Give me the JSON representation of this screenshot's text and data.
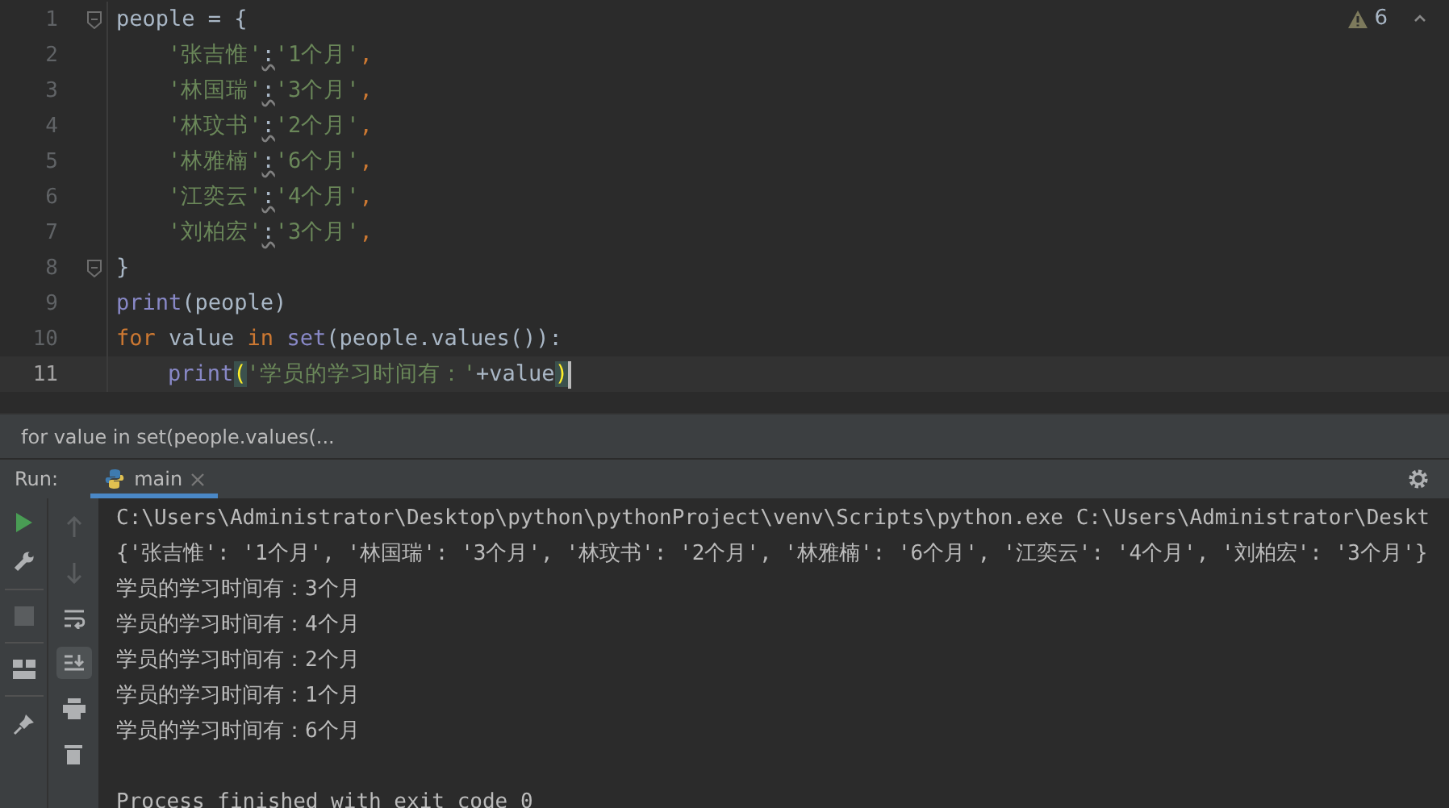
{
  "editor": {
    "warnings": {
      "count": "6"
    },
    "lines": [
      {
        "number": "1",
        "current": false,
        "fold": true,
        "indented": false,
        "tokens": [
          {
            "kind": "plain",
            "text": "people = {"
          }
        ]
      },
      {
        "number": "2",
        "current": false,
        "fold": false,
        "indented": true,
        "tokens": [
          {
            "kind": "string",
            "text": "'张吉惟'"
          },
          {
            "kind": "warn",
            "text": ":"
          },
          {
            "kind": "string",
            "text": "'1个月'"
          },
          {
            "kind": "keyword",
            "text": ","
          }
        ]
      },
      {
        "number": "3",
        "current": false,
        "fold": false,
        "indented": true,
        "tokens": [
          {
            "kind": "string",
            "text": "'林国瑞'"
          },
          {
            "kind": "warn",
            "text": ":"
          },
          {
            "kind": "string",
            "text": "'3个月'"
          },
          {
            "kind": "keyword",
            "text": ","
          }
        ]
      },
      {
        "number": "4",
        "current": false,
        "fold": false,
        "indented": true,
        "tokens": [
          {
            "kind": "string",
            "text": "'林玟书'"
          },
          {
            "kind": "warn",
            "text": ":"
          },
          {
            "kind": "string",
            "text": "'2个月'"
          },
          {
            "kind": "keyword",
            "text": ","
          }
        ]
      },
      {
        "number": "5",
        "current": false,
        "fold": false,
        "indented": true,
        "tokens": [
          {
            "kind": "string",
            "text": "'林雅楠'"
          },
          {
            "kind": "warn",
            "text": ":"
          },
          {
            "kind": "string",
            "text": "'6个月'"
          },
          {
            "kind": "keyword",
            "text": ","
          }
        ]
      },
      {
        "number": "6",
        "current": false,
        "fold": false,
        "indented": true,
        "tokens": [
          {
            "kind": "string",
            "text": "'江奕云'"
          },
          {
            "kind": "warn",
            "text": ":"
          },
          {
            "kind": "string",
            "text": "'4个月'"
          },
          {
            "kind": "keyword",
            "text": ","
          }
        ]
      },
      {
        "number": "7",
        "current": false,
        "fold": false,
        "indented": true,
        "tokens": [
          {
            "kind": "string",
            "text": "'刘柏宏'"
          },
          {
            "kind": "warn",
            "text": ":"
          },
          {
            "kind": "string",
            "text": "'3个月'"
          },
          {
            "kind": "keyword",
            "text": ","
          }
        ]
      },
      {
        "number": "8",
        "current": false,
        "fold": true,
        "indented": false,
        "tokens": [
          {
            "kind": "plain",
            "text": "}"
          }
        ]
      },
      {
        "number": "9",
        "current": false,
        "fold": false,
        "indented": false,
        "tokens": [
          {
            "kind": "builtin",
            "text": "print"
          },
          {
            "kind": "plain",
            "text": "(people)"
          }
        ]
      },
      {
        "number": "10",
        "current": false,
        "fold": false,
        "indented": false,
        "tokens": [
          {
            "kind": "keyword",
            "text": "for"
          },
          {
            "kind": "plain",
            "text": " value "
          },
          {
            "kind": "keyword",
            "text": "in"
          },
          {
            "kind": "builtin",
            "text": " set"
          },
          {
            "kind": "plain",
            "text": "(people.values()):"
          }
        ]
      },
      {
        "number": "11",
        "current": true,
        "fold": false,
        "indented": true,
        "tokens": [
          {
            "kind": "builtin",
            "text": "print"
          },
          {
            "kind": "match",
            "text": "("
          },
          {
            "kind": "string",
            "text": "'学员的学习时间有：'"
          },
          {
            "kind": "plain",
            "text": "+value"
          },
          {
            "kind": "match",
            "text": ")"
          }
        ]
      }
    ]
  },
  "breadcrumb": "for value in set(people.values(...",
  "run": {
    "label": "Run:",
    "tabs": [
      {
        "label": "main",
        "selected": true
      }
    ],
    "console": [
      {
        "kind": "output",
        "text": "C:\\Users\\Administrator\\Desktop\\python\\pythonProject\\venv\\Scripts\\python.exe C:\\Users\\Administrator\\Deskt"
      },
      {
        "kind": "output",
        "text": "{'张吉惟': '1个月', '林国瑞': '3个月', '林玟书': '2个月', '林雅楠': '6个月', '江奕云': '4个月', '刘柏宏': '3个月'}"
      },
      {
        "kind": "output",
        "text": "学员的学习时间有：3个月"
      },
      {
        "kind": "output",
        "text": "学员的学习时间有：4个月"
      },
      {
        "kind": "output",
        "text": "学员的学习时间有：2个月"
      },
      {
        "kind": "output",
        "text": "学员的学习时间有：1个月"
      },
      {
        "kind": "output",
        "text": "学员的学习时间有：6个月"
      },
      {
        "kind": "status",
        "text": "Process finished with exit code 0"
      }
    ]
  }
}
